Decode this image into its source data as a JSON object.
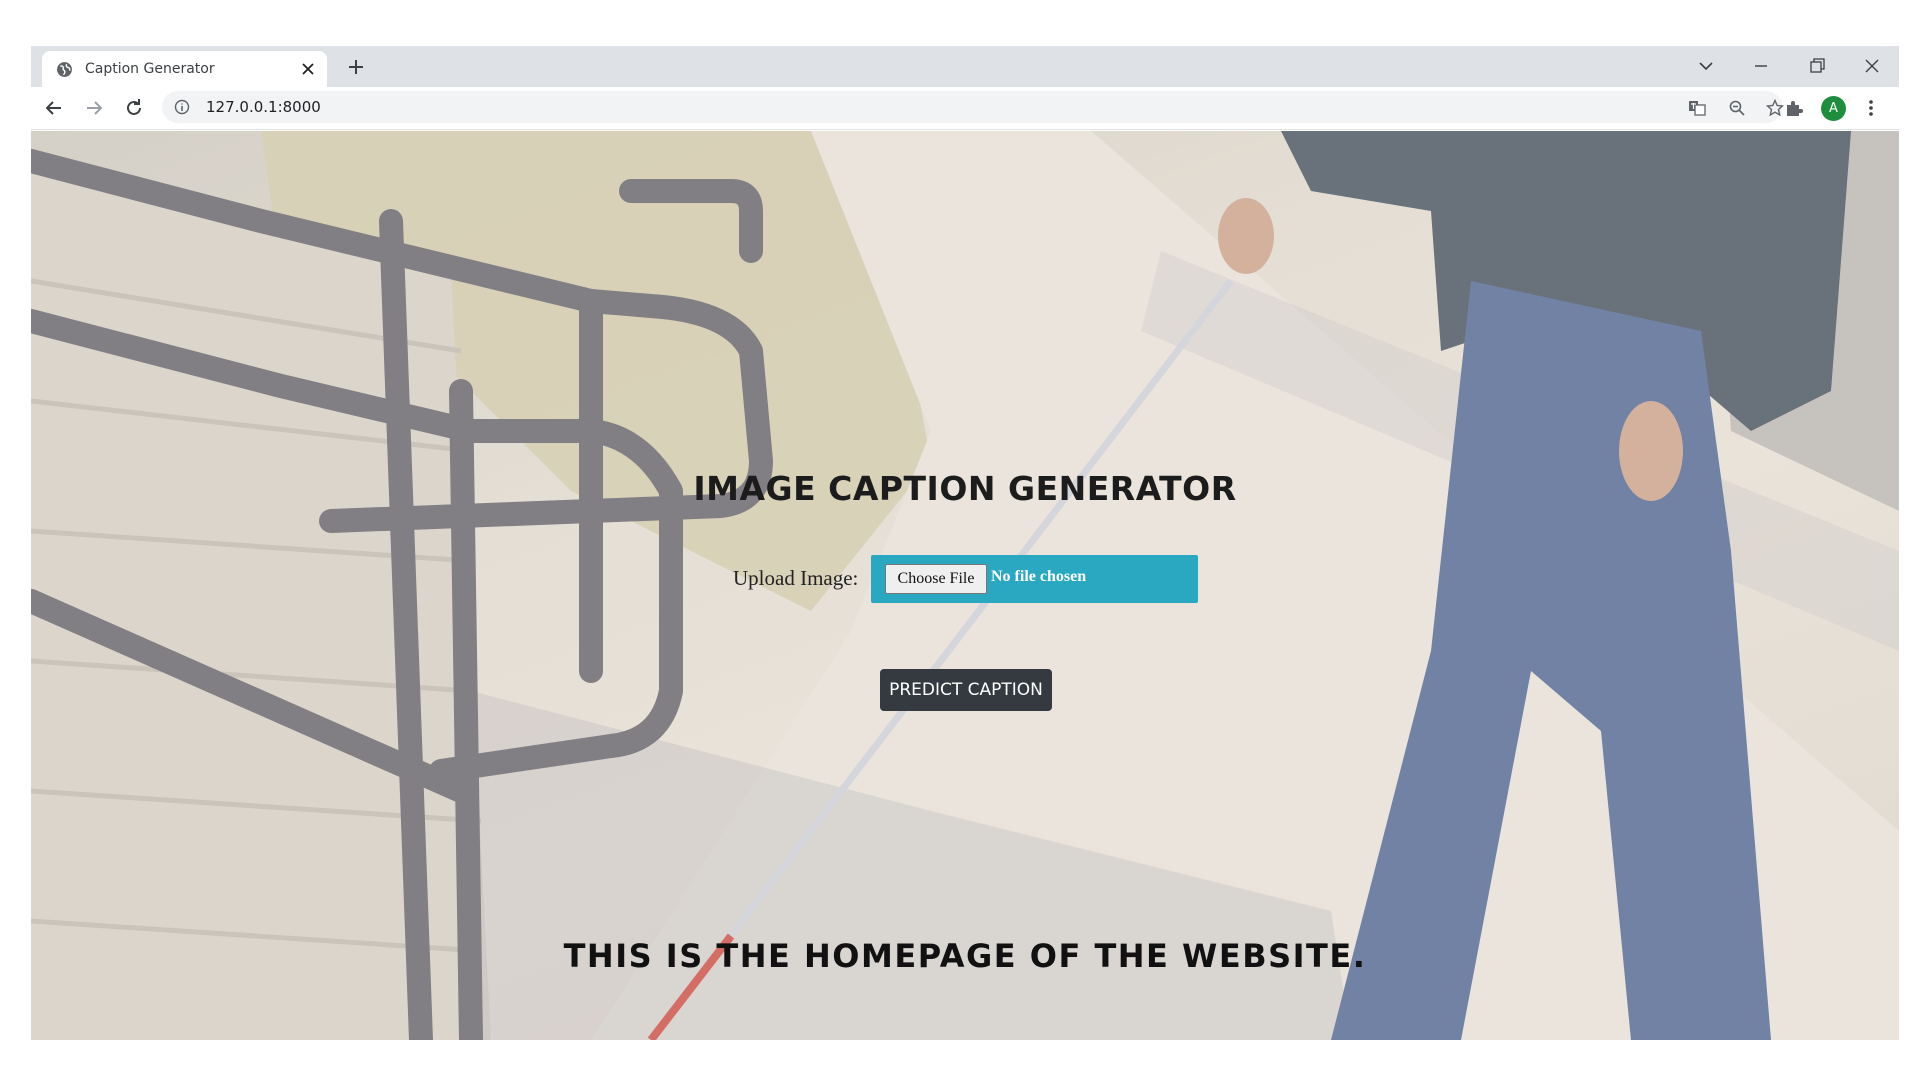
{
  "browser": {
    "tab_title": "Caption Generator",
    "url": "127.0.0.1:8000",
    "profile_initial": "A"
  },
  "page": {
    "title": "IMAGE CAPTION GENERATOR",
    "upload_label": "Upload Image:",
    "choose_file_label": "Choose File",
    "no_file_text": "No file chosen",
    "predict_button": "PREDICT CAPTION",
    "footer": "THIS IS THE HOMEPAGE OF THE WEBSITE."
  },
  "colors": {
    "file_box": "#2aa8c1",
    "predict_button": "#343a40",
    "avatar": "#1e8e3e"
  }
}
